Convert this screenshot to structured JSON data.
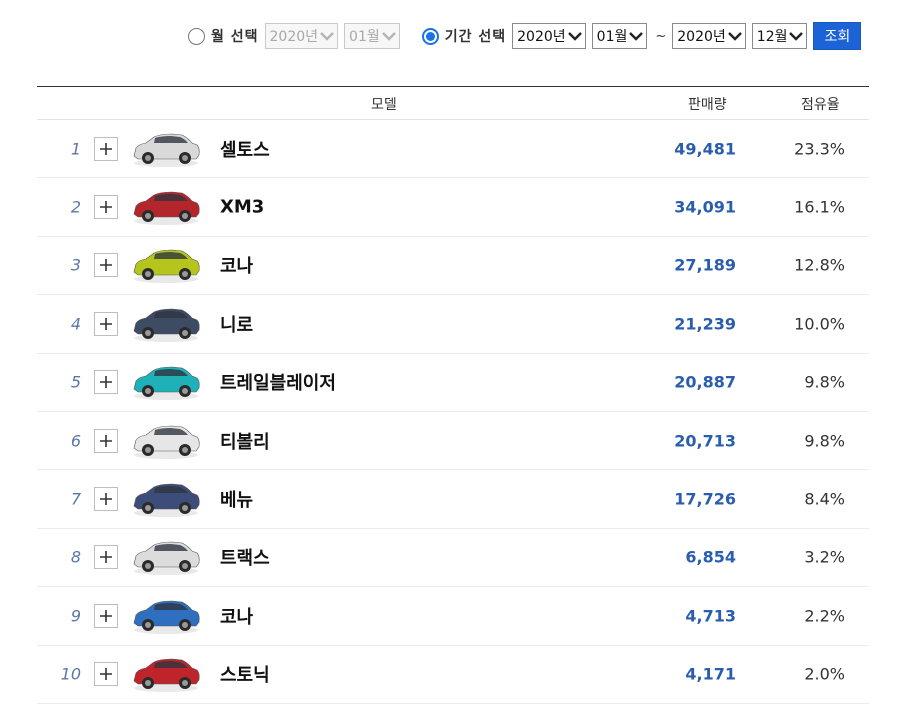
{
  "filter": {
    "month_radio_label": "월 선택",
    "month_year": "2020년",
    "month_month": "01월",
    "period_radio_label": "기간 선택",
    "from_year": "2020년",
    "from_month": "01월",
    "separator": "~",
    "to_year": "2020년",
    "to_month": "12월",
    "search_button": "조회",
    "selected": "period",
    "accent_color": "#1d63d8"
  },
  "table": {
    "headers": {
      "model": "모델",
      "sales": "판매량",
      "share": "점유율"
    },
    "rows": [
      {
        "rank": "1",
        "name": "셀토스",
        "sales": "49,481",
        "share": "23.3%",
        "car_color": "#d9d9d9"
      },
      {
        "rank": "2",
        "name": "XM3",
        "sales": "34,091",
        "share": "16.1%",
        "car_color": "#b3262b"
      },
      {
        "rank": "3",
        "name": "코나",
        "sales": "27,189",
        "share": "12.8%",
        "car_color": "#b5c51c"
      },
      {
        "rank": "4",
        "name": "니로",
        "sales": "21,239",
        "share": "10.0%",
        "car_color": "#3d4b63"
      },
      {
        "rank": "5",
        "name": "트레일블레이저",
        "sales": "20,887",
        "share": "9.8%",
        "car_color": "#1fb1b8"
      },
      {
        "rank": "6",
        "name": "티볼리",
        "sales": "20,713",
        "share": "9.8%",
        "car_color": "#e6e6e6"
      },
      {
        "rank": "7",
        "name": "베뉴",
        "sales": "17,726",
        "share": "8.4%",
        "car_color": "#3b4d78"
      },
      {
        "rank": "8",
        "name": "트랙스",
        "sales": "6,854",
        "share": "3.2%",
        "car_color": "#dcdcdc"
      },
      {
        "rank": "9",
        "name": "코나",
        "sales": "4,713",
        "share": "2.2%",
        "car_color": "#2f6fc0"
      },
      {
        "rank": "10",
        "name": "스토닉",
        "sales": "4,171",
        "share": "2.0%",
        "car_color": "#c0242b"
      }
    ]
  }
}
